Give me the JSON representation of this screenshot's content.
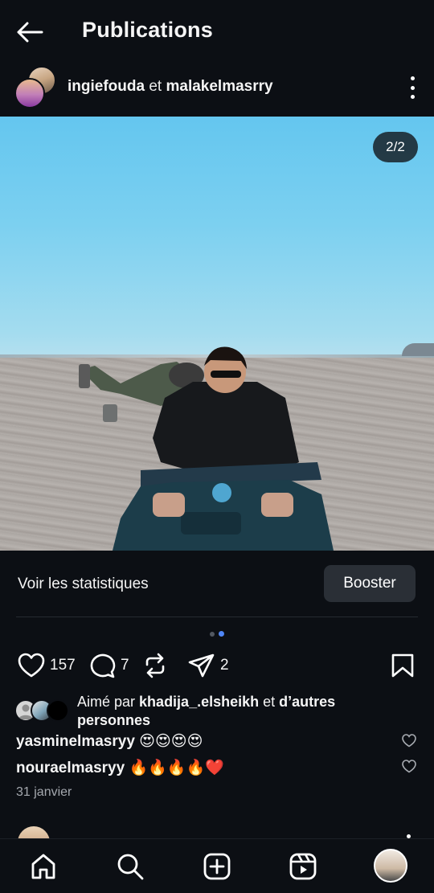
{
  "header": {
    "title": "Publications"
  },
  "post": {
    "author_primary": "ingiefouda",
    "author_connector": "et",
    "author_secondary": "malakelmasrry",
    "image_counter": "2/2",
    "image_description": "two people riding a quad bike on a beach"
  },
  "insights": {
    "stats_label": "Voir les statistiques",
    "boost_label": "Booster"
  },
  "carousel": {
    "total": 2,
    "active_index": 2
  },
  "actions": {
    "likes_count": "157",
    "comments_count": "7",
    "shares_count": "2"
  },
  "likes": {
    "prefix": "Aimé par",
    "first_user": "khadija_.elsheikh",
    "connector": "et",
    "others": "d’autres personnes"
  },
  "comments": [
    {
      "user": "yasminelmasryy",
      "text": "😍😍😍😍"
    },
    {
      "user": "nouraelmasryy",
      "text": "🔥🔥🔥🔥❤️"
    }
  ],
  "date": "31 janvier",
  "colors": {
    "background": "#0c0f14",
    "accent_dot": "#4f86f7",
    "boost_button": "#2a2f36"
  },
  "nav": {
    "items": [
      "home-icon",
      "search-icon",
      "create-icon",
      "reels-icon",
      "profile-avatar"
    ]
  }
}
